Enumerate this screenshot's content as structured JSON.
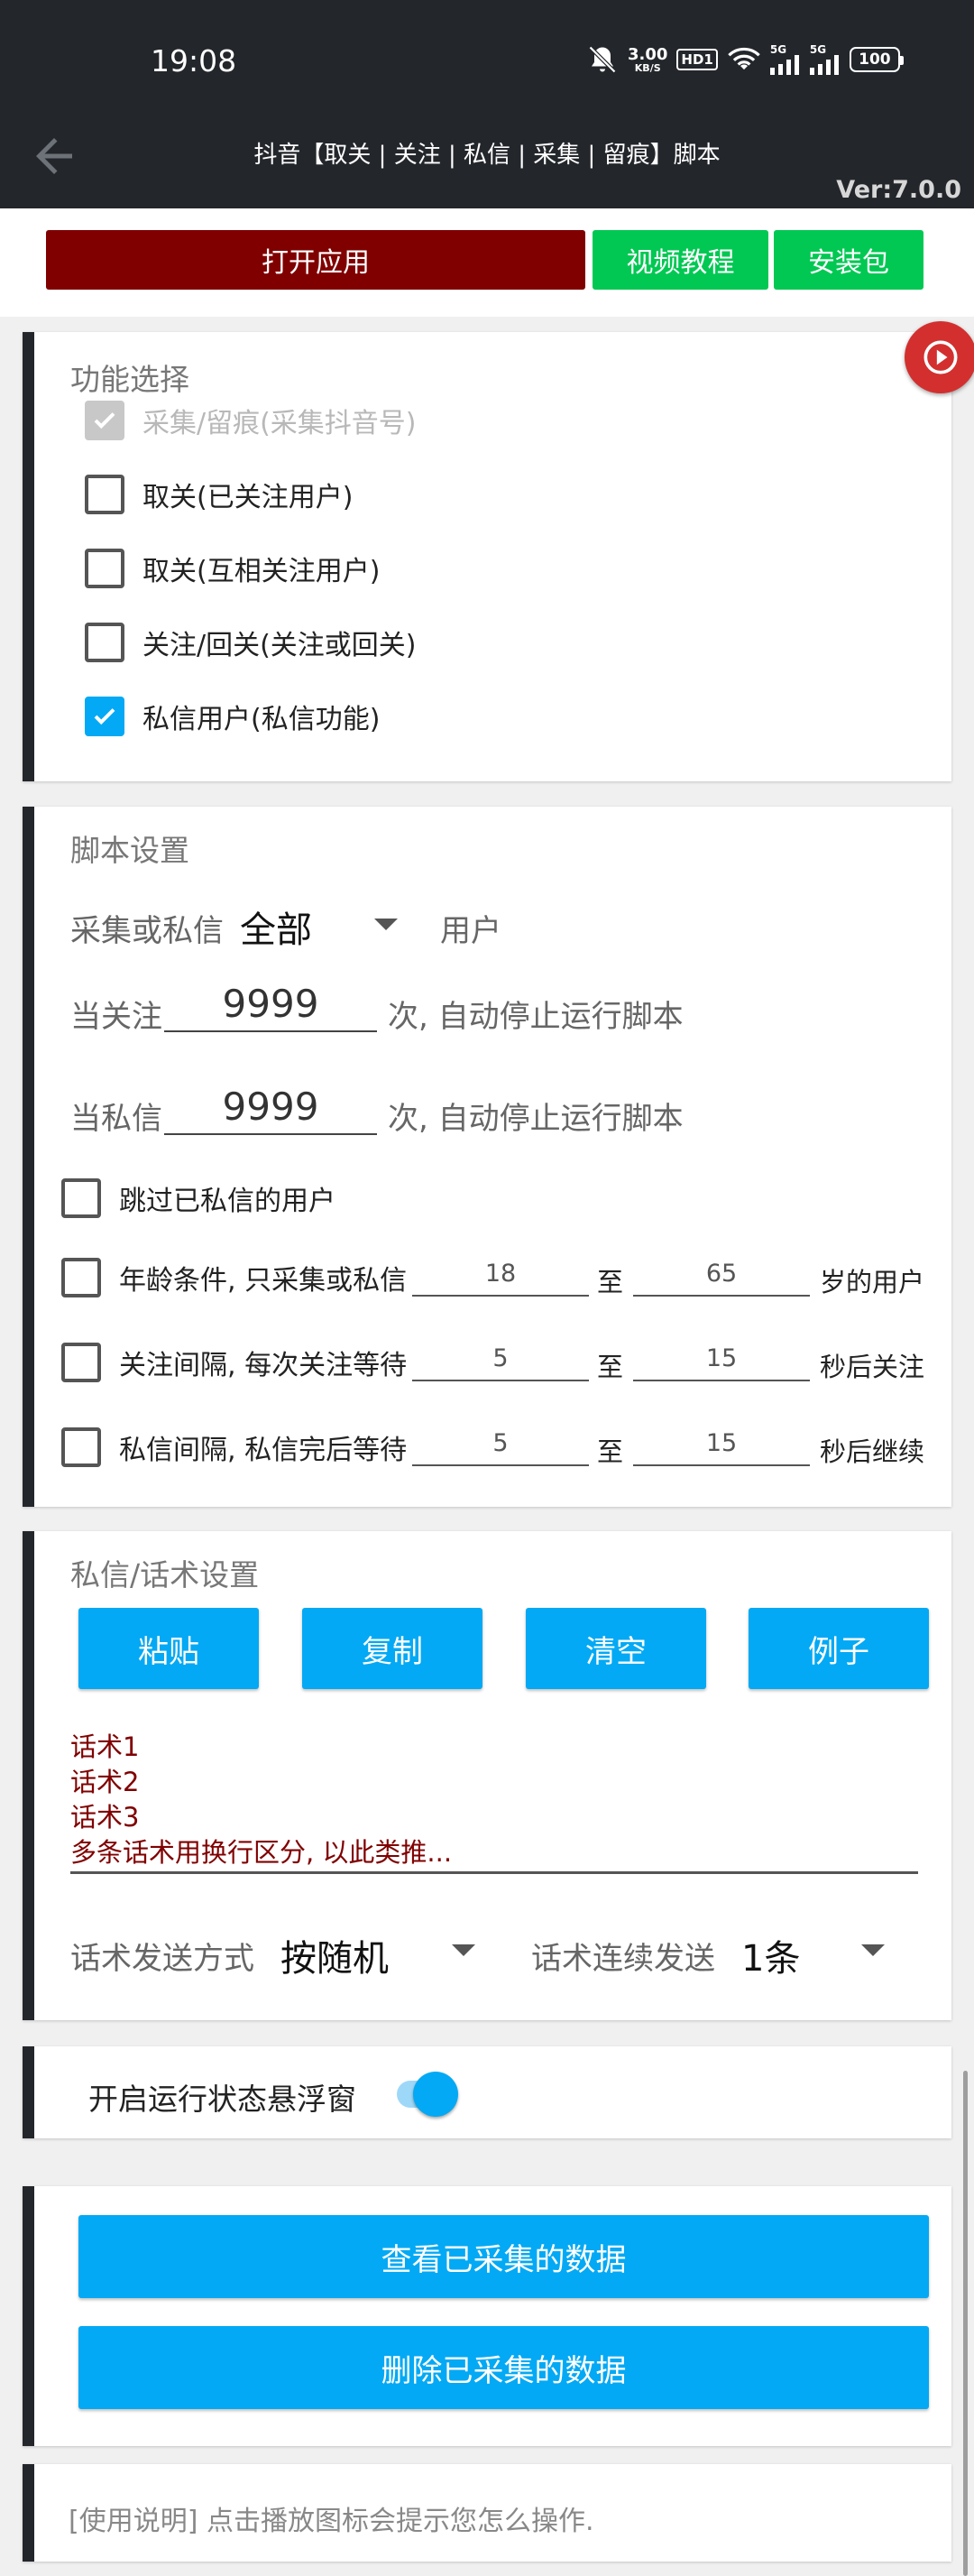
{
  "status_bar": {
    "time": "19:08",
    "net_speed_value": "3.00",
    "net_speed_unit": "KB/S",
    "hd_badge": "HD1",
    "signal1": "5G",
    "signal2": "5G",
    "battery": "100",
    "icons": [
      "mute-icon",
      "wifi-icon",
      "signal-icon",
      "signal-icon",
      "battery-icon"
    ]
  },
  "app_bar": {
    "title": "抖音【取关 | 关注 | 私信 | 采集 | 留痕】脚本",
    "version": "Ver:7.0.0"
  },
  "top_buttons": {
    "open_app": "打开应用",
    "video_tutorial": "视频教程",
    "install_package": "安装包"
  },
  "function_select": {
    "title": "功能选择",
    "options": [
      {
        "label": "采集/留痕(采集抖音号)",
        "checked": true,
        "disabled": true
      },
      {
        "label": "取关(已关注用户)",
        "checked": false,
        "disabled": false
      },
      {
        "label": "取关(互相关注用户)",
        "checked": false,
        "disabled": false
      },
      {
        "label": "关注/回关(关注或回关)",
        "checked": false,
        "disabled": false
      },
      {
        "label": "私信用户(私信功能)",
        "checked": true,
        "disabled": false
      }
    ]
  },
  "script_settings": {
    "title": "脚本设置",
    "collect_label": "采集或私信",
    "collect_value": "全部",
    "collect_suffix": "用户",
    "follow_label": "当关注",
    "follow_value": "9999",
    "follow_suffix": "次, 自动停止运行脚本",
    "dm_label": "当私信",
    "dm_value": "9999",
    "dm_suffix": "次, 自动停止运行脚本",
    "skip_label": "跳过已私信的用户",
    "age_label": "年龄条件, 只采集或私信",
    "age_min": "18",
    "age_to": "至",
    "age_max": "65",
    "age_suffix": "岁的用户",
    "follow_interval_label": "关注间隔, 每次关注等待",
    "follow_interval_min": "5",
    "follow_interval_to": "至",
    "follow_interval_max": "15",
    "follow_interval_suffix": "秒后关注",
    "dm_interval_label": "私信间隔, 私信完后等待",
    "dm_interval_min": "5",
    "dm_interval_to": "至",
    "dm_interval_max": "15",
    "dm_interval_suffix": "秒后继续"
  },
  "script_text": {
    "title": "私信/话术设置",
    "buttons": [
      "粘贴",
      "复制",
      "清空",
      "例子"
    ],
    "text": "话术1\n话术2\n话术3\n多条话术用换行区分, 以此类推...",
    "send_mode_label": "话术发送方式",
    "send_mode_value": "按随机",
    "continuous_label": "话术连续发送",
    "continuous_value": "1条"
  },
  "floating_window": {
    "label": "开启运行状态悬浮窗",
    "enabled": true
  },
  "data_actions": {
    "view": "查看已采集的数据",
    "delete": "删除已采集的数据"
  },
  "usage_note": "[使用说明] 点击播放图标会提示您怎么操作.",
  "colors": {
    "dark": "#23262b",
    "accent": "#03a9f4",
    "open_app": "#800000",
    "green": "#00c853",
    "play": "#d32f2f"
  }
}
